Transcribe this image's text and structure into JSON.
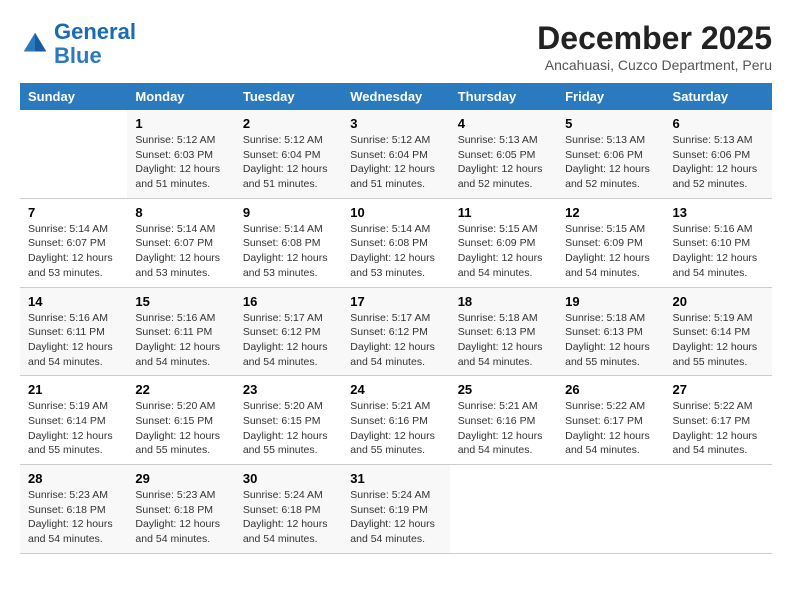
{
  "header": {
    "logo_line1": "General",
    "logo_line2": "Blue",
    "month_year": "December 2025",
    "location": "Ancahuasi, Cuzco Department, Peru"
  },
  "days_of_week": [
    "Sunday",
    "Monday",
    "Tuesday",
    "Wednesday",
    "Thursday",
    "Friday",
    "Saturday"
  ],
  "weeks": [
    [
      {
        "day": "",
        "info": ""
      },
      {
        "day": "1",
        "info": "Sunrise: 5:12 AM\nSunset: 6:03 PM\nDaylight: 12 hours\nand 51 minutes."
      },
      {
        "day": "2",
        "info": "Sunrise: 5:12 AM\nSunset: 6:04 PM\nDaylight: 12 hours\nand 51 minutes."
      },
      {
        "day": "3",
        "info": "Sunrise: 5:12 AM\nSunset: 6:04 PM\nDaylight: 12 hours\nand 51 minutes."
      },
      {
        "day": "4",
        "info": "Sunrise: 5:13 AM\nSunset: 6:05 PM\nDaylight: 12 hours\nand 52 minutes."
      },
      {
        "day": "5",
        "info": "Sunrise: 5:13 AM\nSunset: 6:06 PM\nDaylight: 12 hours\nand 52 minutes."
      },
      {
        "day": "6",
        "info": "Sunrise: 5:13 AM\nSunset: 6:06 PM\nDaylight: 12 hours\nand 52 minutes."
      }
    ],
    [
      {
        "day": "7",
        "info": "Sunrise: 5:14 AM\nSunset: 6:07 PM\nDaylight: 12 hours\nand 53 minutes."
      },
      {
        "day": "8",
        "info": "Sunrise: 5:14 AM\nSunset: 6:07 PM\nDaylight: 12 hours\nand 53 minutes."
      },
      {
        "day": "9",
        "info": "Sunrise: 5:14 AM\nSunset: 6:08 PM\nDaylight: 12 hours\nand 53 minutes."
      },
      {
        "day": "10",
        "info": "Sunrise: 5:14 AM\nSunset: 6:08 PM\nDaylight: 12 hours\nand 53 minutes."
      },
      {
        "day": "11",
        "info": "Sunrise: 5:15 AM\nSunset: 6:09 PM\nDaylight: 12 hours\nand 54 minutes."
      },
      {
        "day": "12",
        "info": "Sunrise: 5:15 AM\nSunset: 6:09 PM\nDaylight: 12 hours\nand 54 minutes."
      },
      {
        "day": "13",
        "info": "Sunrise: 5:16 AM\nSunset: 6:10 PM\nDaylight: 12 hours\nand 54 minutes."
      }
    ],
    [
      {
        "day": "14",
        "info": "Sunrise: 5:16 AM\nSunset: 6:11 PM\nDaylight: 12 hours\nand 54 minutes."
      },
      {
        "day": "15",
        "info": "Sunrise: 5:16 AM\nSunset: 6:11 PM\nDaylight: 12 hours\nand 54 minutes."
      },
      {
        "day": "16",
        "info": "Sunrise: 5:17 AM\nSunset: 6:12 PM\nDaylight: 12 hours\nand 54 minutes."
      },
      {
        "day": "17",
        "info": "Sunrise: 5:17 AM\nSunset: 6:12 PM\nDaylight: 12 hours\nand 54 minutes."
      },
      {
        "day": "18",
        "info": "Sunrise: 5:18 AM\nSunset: 6:13 PM\nDaylight: 12 hours\nand 54 minutes."
      },
      {
        "day": "19",
        "info": "Sunrise: 5:18 AM\nSunset: 6:13 PM\nDaylight: 12 hours\nand 55 minutes."
      },
      {
        "day": "20",
        "info": "Sunrise: 5:19 AM\nSunset: 6:14 PM\nDaylight: 12 hours\nand 55 minutes."
      }
    ],
    [
      {
        "day": "21",
        "info": "Sunrise: 5:19 AM\nSunset: 6:14 PM\nDaylight: 12 hours\nand 55 minutes."
      },
      {
        "day": "22",
        "info": "Sunrise: 5:20 AM\nSunset: 6:15 PM\nDaylight: 12 hours\nand 55 minutes."
      },
      {
        "day": "23",
        "info": "Sunrise: 5:20 AM\nSunset: 6:15 PM\nDaylight: 12 hours\nand 55 minutes."
      },
      {
        "day": "24",
        "info": "Sunrise: 5:21 AM\nSunset: 6:16 PM\nDaylight: 12 hours\nand 55 minutes."
      },
      {
        "day": "25",
        "info": "Sunrise: 5:21 AM\nSunset: 6:16 PM\nDaylight: 12 hours\nand 54 minutes."
      },
      {
        "day": "26",
        "info": "Sunrise: 5:22 AM\nSunset: 6:17 PM\nDaylight: 12 hours\nand 54 minutes."
      },
      {
        "day": "27",
        "info": "Sunrise: 5:22 AM\nSunset: 6:17 PM\nDaylight: 12 hours\nand 54 minutes."
      }
    ],
    [
      {
        "day": "28",
        "info": "Sunrise: 5:23 AM\nSunset: 6:18 PM\nDaylight: 12 hours\nand 54 minutes."
      },
      {
        "day": "29",
        "info": "Sunrise: 5:23 AM\nSunset: 6:18 PM\nDaylight: 12 hours\nand 54 minutes."
      },
      {
        "day": "30",
        "info": "Sunrise: 5:24 AM\nSunset: 6:18 PM\nDaylight: 12 hours\nand 54 minutes."
      },
      {
        "day": "31",
        "info": "Sunrise: 5:24 AM\nSunset: 6:19 PM\nDaylight: 12 hours\nand 54 minutes."
      },
      {
        "day": "",
        "info": ""
      },
      {
        "day": "",
        "info": ""
      },
      {
        "day": "",
        "info": ""
      }
    ]
  ]
}
